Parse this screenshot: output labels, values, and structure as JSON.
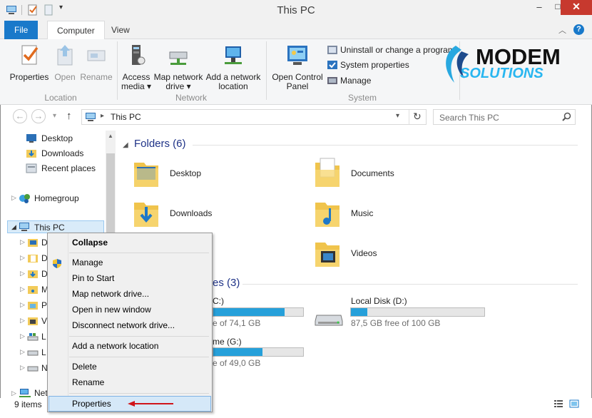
{
  "window": {
    "title": "This PC"
  },
  "controls": {
    "minimize": "–",
    "maximize": "□",
    "close": "✕"
  },
  "tabs": {
    "file": "File",
    "computer": "Computer",
    "view": "View"
  },
  "ribbon": {
    "properties": "Properties",
    "open": "Open",
    "rename": "Rename",
    "access_media_1": "Access",
    "access_media_2": "media ▾",
    "map_drive_1": "Map network",
    "map_drive_2": "drive ▾",
    "add_location_1": "Add a network",
    "add_location_2": "location",
    "control_panel_1": "Open Control",
    "control_panel_2": "Panel",
    "uninstall": "Uninstall or change a program",
    "system_properties": "System properties",
    "manage": "Manage",
    "group_location": "Location",
    "group_network": "Network",
    "group_system": "System"
  },
  "logo": {
    "line1": "MODEM",
    "line2": "SOLUTIONS"
  },
  "address": {
    "path": "This PC",
    "search_placeholder": "Search This PC"
  },
  "nav": {
    "desktop": "Desktop",
    "downloads": "Downloads",
    "recent": "Recent places",
    "homegroup": "Homegroup",
    "thispc": "This PC",
    "c1": "D",
    "c2": "D",
    "c3": "D",
    "c4": "M",
    "c5": "P",
    "c6": "V",
    "c7": "L",
    "c8": "L",
    "c9": "N",
    "network": "Net"
  },
  "content": {
    "folders_header": "Folders (6)",
    "devices_header": "es (3)",
    "folders": [
      "Desktop",
      "Documents",
      "Downloads",
      "Music",
      "Videos"
    ],
    "drive_c_label": "C:)",
    "drive_c_free": "e of 74,1 GB",
    "drive_c_used": 0.79,
    "drive_d_label": "Local Disk (D:)",
    "drive_d_free": "87,5 GB free of 100 GB",
    "drive_d_used": 0.125,
    "drive_g_label": "me (G:)",
    "drive_g_free": "e of 49,0 GB",
    "drive_g_used": 0.55
  },
  "context_menu": {
    "collapse": "Collapse",
    "manage": "Manage",
    "pin": "Pin to Start",
    "map": "Map network drive...",
    "open_new": "Open in new window",
    "disconnect": "Disconnect network drive...",
    "add_location": "Add a network location",
    "delete": "Delete",
    "rename": "Rename",
    "properties": "Properties"
  },
  "status": {
    "items": "9 items"
  },
  "colors": {
    "accent": "#1979ca",
    "bar": "#26a0da",
    "arrow": "#d0141a",
    "close": "#c7392e"
  }
}
